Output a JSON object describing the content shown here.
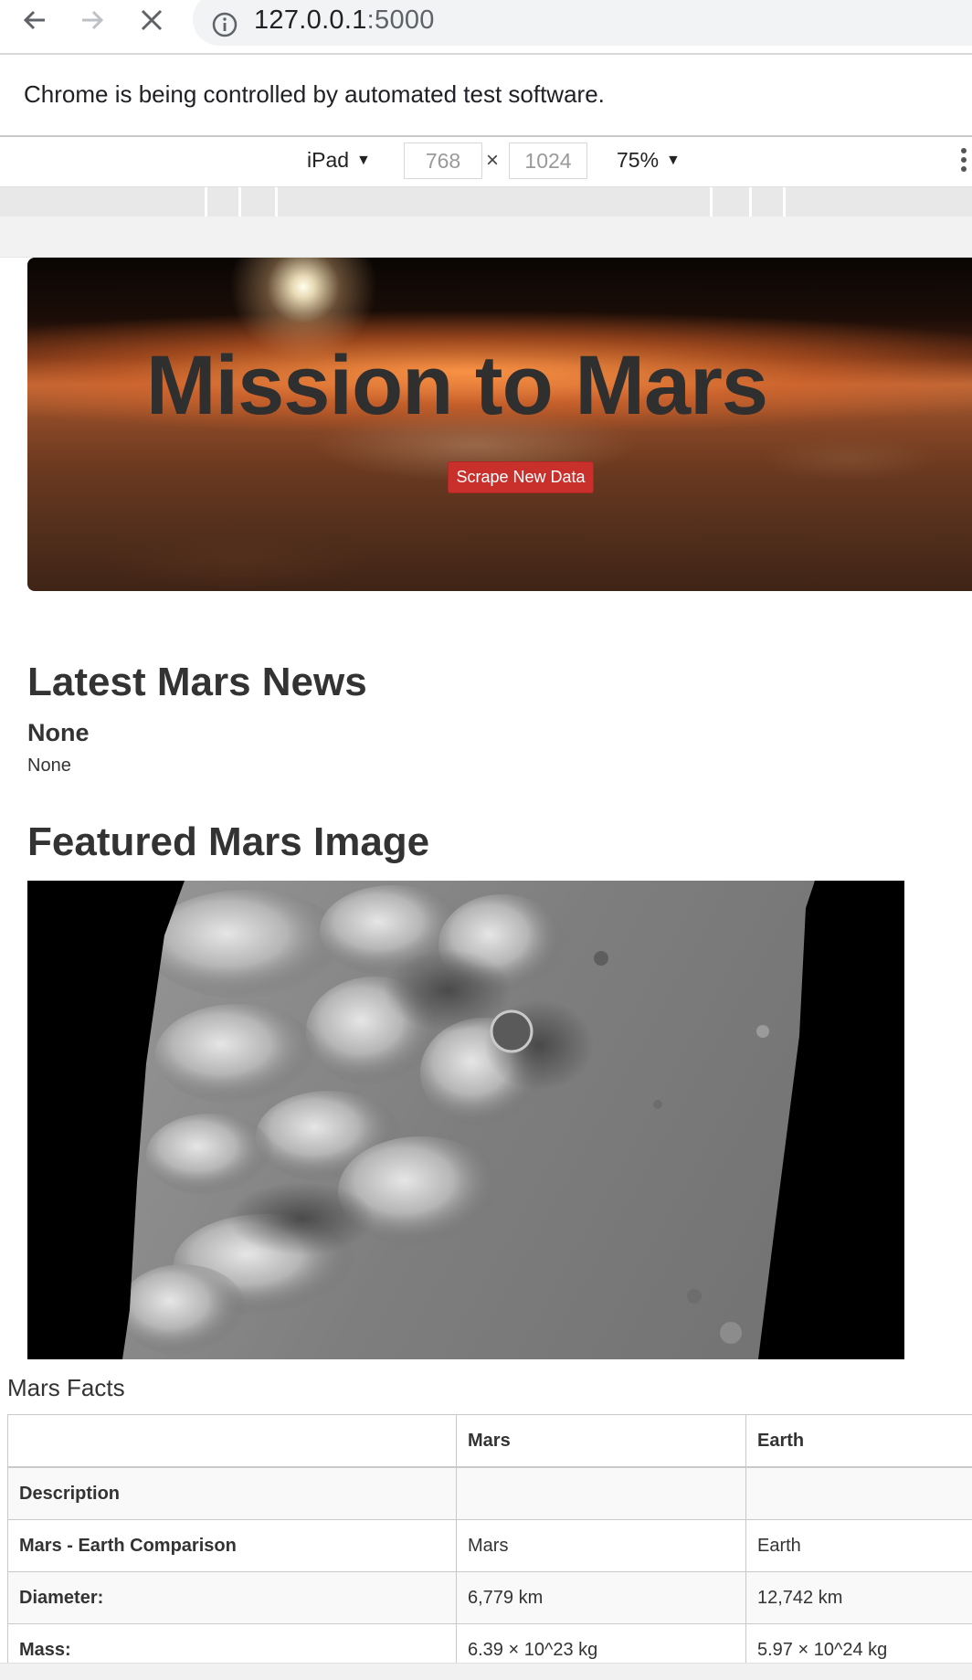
{
  "browser": {
    "url_host": "127.0.0.1",
    "url_port": ":5000",
    "infobar_text": "Chrome is being controlled by automated test software."
  },
  "devtools": {
    "device": "iPad",
    "width": "768",
    "times": "×",
    "height": "1024",
    "zoom": "75%",
    "caret": "▼"
  },
  "jumbotron": {
    "title": "Mission to Mars",
    "button_label": "Scrape New Data"
  },
  "news": {
    "heading": "Latest Mars News",
    "title": "None",
    "paragraph": "None"
  },
  "featured": {
    "heading": "Featured Mars Image"
  },
  "facts": {
    "heading": "Mars Facts",
    "columns": [
      "",
      "Mars",
      "Earth"
    ],
    "rows": [
      [
        "Description",
        "",
        ""
      ],
      [
        "Mars - Earth Comparison",
        "Mars",
        "Earth"
      ],
      [
        "Diameter:",
        "6,779 km",
        "12,742 km"
      ],
      [
        "Mass:",
        "6.39 × 10^23 kg",
        "5.97 × 10^24 kg"
      ]
    ]
  }
}
